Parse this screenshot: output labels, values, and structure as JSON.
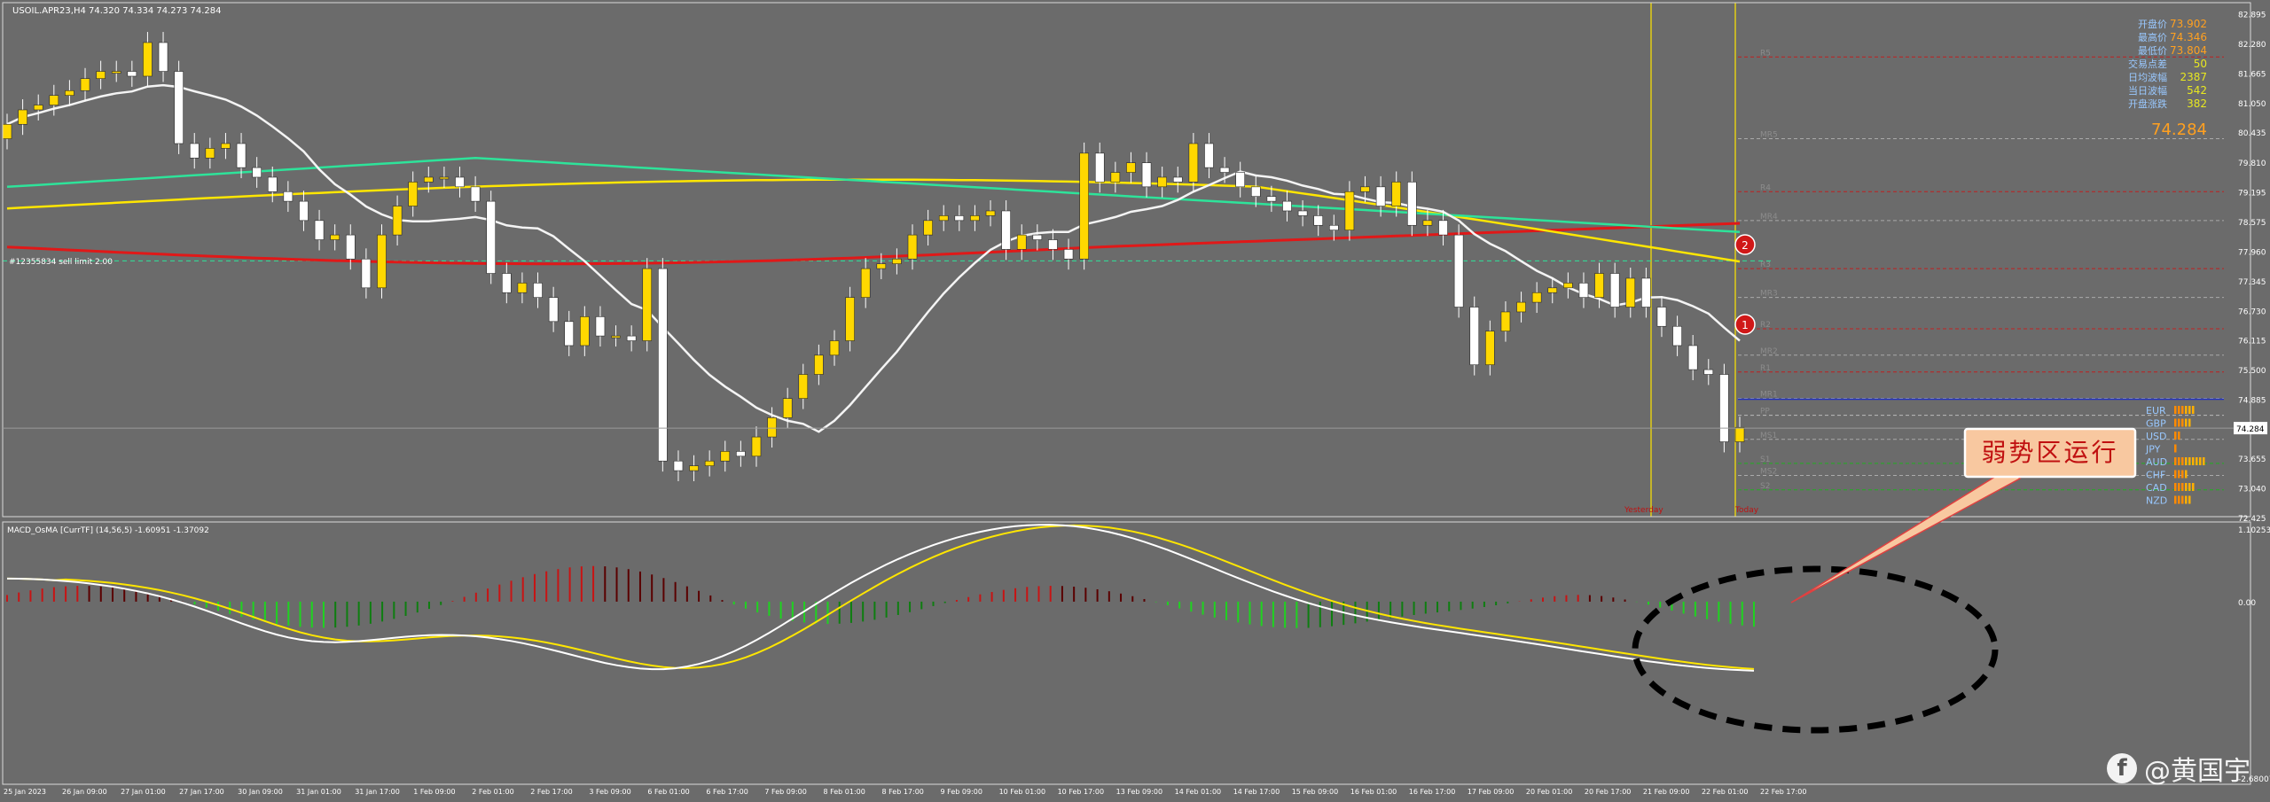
{
  "colors": {
    "background": "#6b6b6b",
    "bull_candle": "#ffd800",
    "bear_candle": "#ffffff",
    "ma_white": "#f4f4f4",
    "ma_green": "#2ee39a",
    "ma_yellow": "#ffe600",
    "ma_red": "#e01818",
    "osma_green": "#1fd320",
    "osma_red": "#c81414",
    "osma_dark_red": "#5a0000",
    "macd_white": "#ffffff",
    "macd_signal": "#ffe600",
    "callout_fill": "#f8c8a0",
    "callout_text": "#c01010"
  },
  "main_chart": {
    "title": "USOIL.APR23,H4  74.320 74.334 74.273 74.284",
    "order_label": "#12355834 sell limit 2.00",
    "current_price_label": "74.284",
    "vlines": [
      "Yesterday",
      "Today"
    ],
    "level_labels": [
      "R5",
      "MR5",
      "R4",
      "MR4",
      "R3",
      "MR3",
      "R2",
      "MR2",
      "R1",
      "MR1",
      "PP",
      "MS1",
      "S1",
      "MS2",
      "S2"
    ],
    "currency_labels": [
      "EUR",
      "GBP",
      "USD",
      "JPY",
      "AUD",
      "CHF",
      "CAD",
      "NZD"
    ],
    "markers": [
      "1",
      "2"
    ],
    "info_panel": {
      "rows": [
        {
          "label": "开盘价",
          "value": "73.902"
        },
        {
          "label": "最高价",
          "value": "74.346"
        },
        {
          "label": "最低价",
          "value": "73.804"
        },
        {
          "label": "交易点差",
          "value": "50"
        },
        {
          "label": "日均波幅",
          "value": "2387"
        },
        {
          "label": "当日波幅",
          "value": "542"
        },
        {
          "label": "开盘涨跌",
          "value": "382"
        }
      ],
      "big_price": "74.284"
    }
  },
  "sub_chart": {
    "title": "MACD_OsMA [CurrTF] (14,56,5) -1.60951 -1.37092"
  },
  "annotation": {
    "callout_text": "弱势区运行"
  },
  "watermark": {
    "icon": "facebook-icon",
    "text": "@黄国宇"
  },
  "chart_data": [
    {
      "type": "candlestick",
      "title": "USOIL.APR23,H4",
      "ylim": [
        72.425,
        83.0
      ],
      "y_ticks": [
        "82.895",
        "82.280",
        "81.665",
        "81.050",
        "80.435",
        "79.810",
        "79.195",
        "78.575",
        "77.960",
        "77.345",
        "76.730",
        "76.115",
        "75.500",
        "74.885",
        "74.284",
        "73.655",
        "73.040",
        "72.425"
      ],
      "x_ticks": [
        "25 Jan 2023",
        "26 Jan 09:00",
        "27 Jan 01:00",
        "27 Jan 17:00",
        "30 Jan 09:00",
        "31 Jan 01:00",
        "31 Jan 17:00",
        "1 Feb 09:00",
        "2 Feb 01:00",
        "2 Feb 17:00",
        "3 Feb 09:00",
        "6 Feb 01:00",
        "6 Feb 17:00",
        "7 Feb 09:00",
        "8 Feb 01:00",
        "8 Feb 17:00",
        "9 Feb 09:00",
        "10 Feb 01:00",
        "10 Feb 17:00",
        "13 Feb 09:00",
        "14 Feb 01:00",
        "14 Feb 17:00",
        "15 Feb 09:00",
        "16 Feb 01:00",
        "16 Feb 17:00",
        "17 Feb 09:00",
        "20 Feb 01:00",
        "20 Feb 17:00",
        "21 Feb 09:00",
        "22 Feb 01:00",
        "22 Feb 17:00"
      ],
      "close": [
        80.6,
        80.9,
        81.0,
        81.2,
        81.3,
        81.55,
        81.7,
        81.7,
        81.6,
        82.3,
        81.7,
        80.2,
        79.9,
        80.1,
        80.2,
        79.7,
        79.5,
        79.2,
        79.0,
        78.6,
        78.2,
        78.3,
        77.8,
        77.2,
        78.3,
        78.9,
        79.4,
        79.5,
        79.5,
        79.3,
        79.0,
        77.5,
        77.1,
        77.3,
        77.0,
        76.5,
        76.0,
        76.6,
        76.2,
        76.2,
        76.1,
        77.6,
        73.6,
        73.4,
        73.5,
        73.6,
        73.8,
        73.7,
        74.1,
        74.5,
        74.9,
        75.4,
        75.8,
        76.1,
        77.0,
        77.6,
        77.7,
        77.8,
        78.3,
        78.6,
        78.7,
        78.6,
        78.7,
        78.8,
        78.0,
        78.3,
        78.2,
        78.0,
        77.8,
        80.0,
        79.4,
        79.6,
        79.8,
        79.3,
        79.5,
        79.4,
        80.2,
        79.7,
        79.6,
        79.3,
        79.1,
        79.0,
        78.8,
        78.7,
        78.5,
        78.4,
        79.2,
        79.3,
        78.9,
        79.4,
        78.5,
        78.6,
        78.3,
        76.8,
        75.6,
        76.3,
        76.7,
        76.9,
        77.1,
        77.2,
        77.3,
        77.0,
        77.5,
        76.8,
        77.4,
        76.8,
        76.4,
        76.0,
        75.5,
        75.4,
        74.0,
        74.3
      ]
    },
    {
      "type": "histogram+line",
      "title": "MACD_OsMA [CurrTF] (14,56,5)",
      "ylim": [
        -2.68007,
        1.10253
      ],
      "y_ticks": [
        "1.10253",
        "0.00",
        "-2.68007"
      ],
      "macd": -1.60951,
      "signal": -1.37092
    }
  ]
}
